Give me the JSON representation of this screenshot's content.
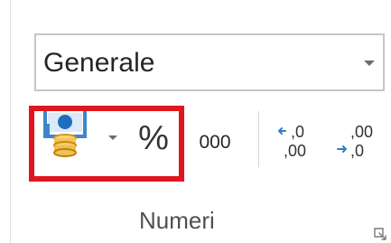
{
  "number_group": {
    "format_select": {
      "value": "Generale"
    },
    "buttons": {
      "currency_icon": "accounting-currency-icon",
      "dropdown_icon": "chevron-down-icon",
      "percent_label": "%",
      "thousands_label": "000",
      "increase_decimal_icon": "increase-decimal-icon",
      "decrease_decimal_icon": "decrease-decimal-icon"
    },
    "group_label": "Numeri",
    "launcher_icon": "dialog-launcher-icon"
  },
  "colors": {
    "highlight": "#e0161e",
    "accent_blue": "#2f7ec8",
    "accent_gold": "#e3a92b"
  }
}
